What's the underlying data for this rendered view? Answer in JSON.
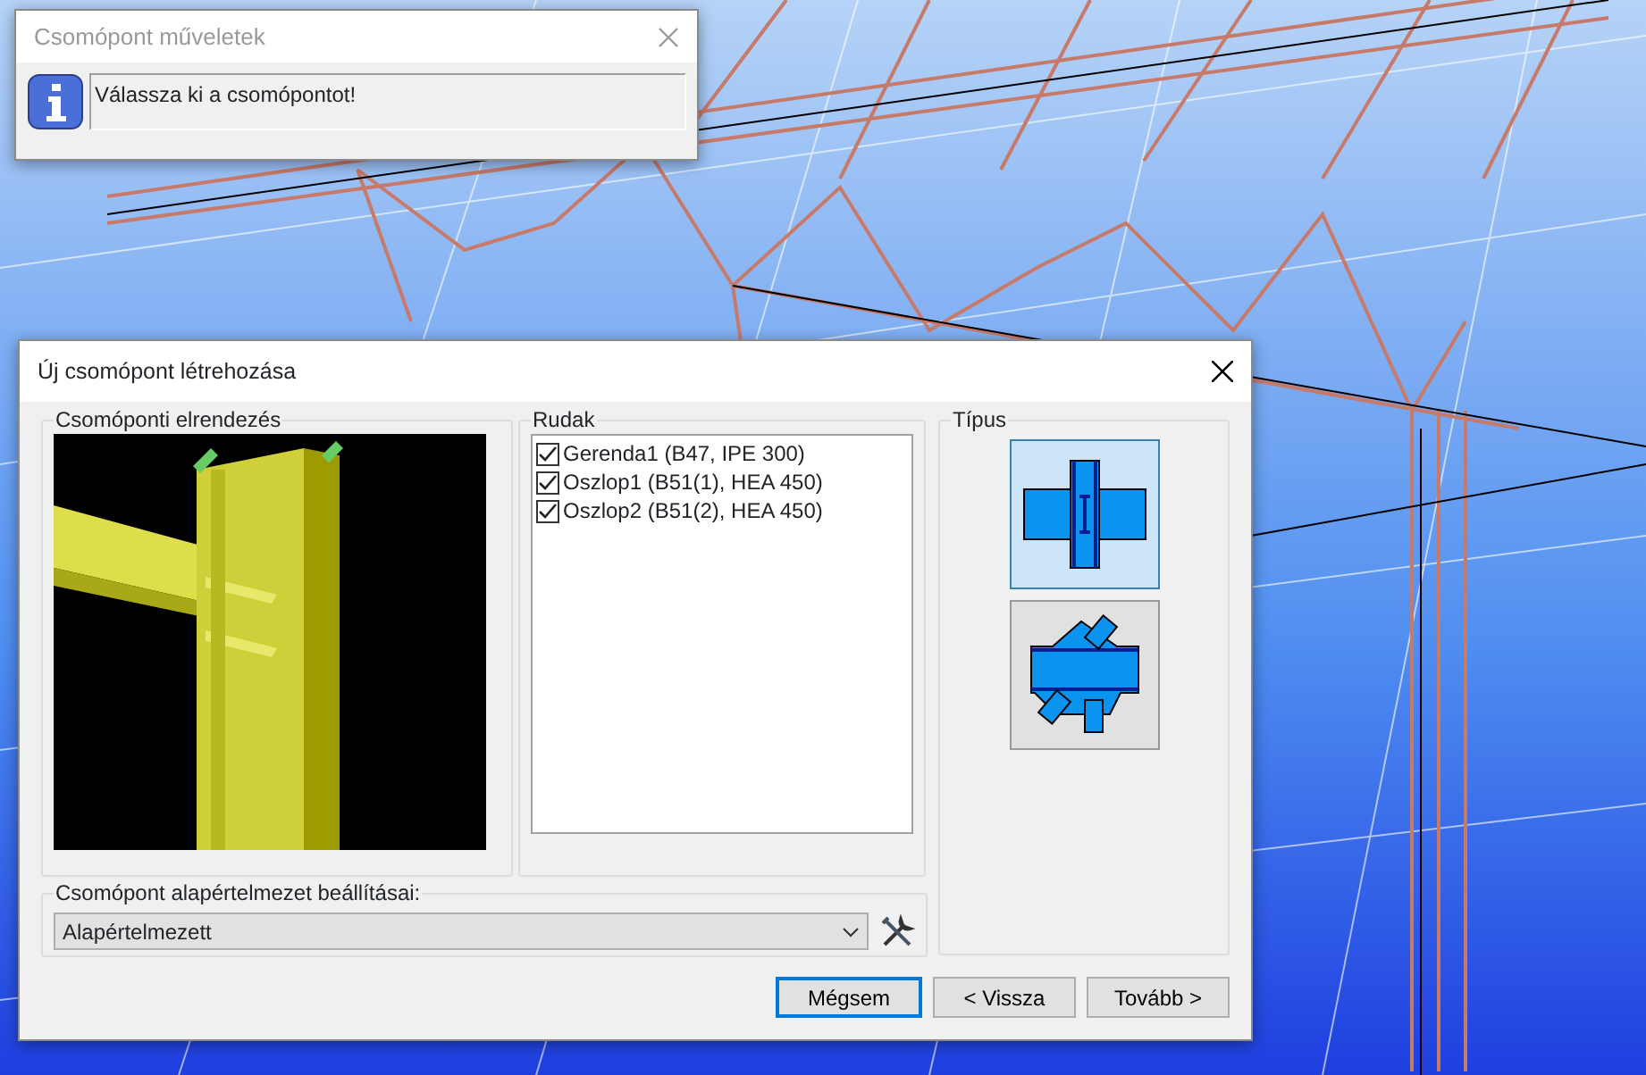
{
  "info_dialog": {
    "title": "Csomópont műveletek",
    "message": "Válassza ki a csomópontot!"
  },
  "dialog": {
    "title": "Új csomópont létrehozása",
    "layout_group": {
      "label": "Csomóponti elrendezés"
    },
    "members_group": {
      "label": "Rudak",
      "items": [
        {
          "label": "Gerenda1 (B47, IPE 300)",
          "checked": true
        },
        {
          "label": "Oszlop1 (B51(1), HEA 450)",
          "checked": true
        },
        {
          "label": "Oszlop2 (B51(2), HEA 450)",
          "checked": true
        }
      ]
    },
    "type_group": {
      "label": "Típus",
      "options": [
        {
          "kind": "beam-column",
          "selected": true
        },
        {
          "kind": "gusset",
          "selected": false
        }
      ]
    },
    "defaults_group": {
      "label": "Csomópont alapértelmezet beállításai:",
      "value": "Alapértelmezett"
    },
    "buttons": [
      {
        "label": "Mégsem",
        "default": true
      },
      {
        "label": "< Vissza",
        "default": false
      },
      {
        "label": "Tovább >",
        "default": false
      }
    ]
  }
}
